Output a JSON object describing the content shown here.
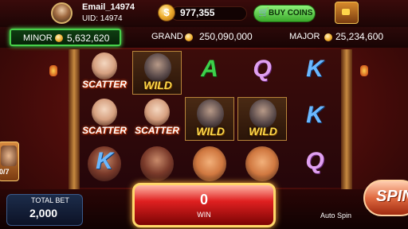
{
  "header": {
    "email": "Email_14974",
    "uid": "UID: 14974",
    "coin_symbol": "$",
    "balance": "977,355",
    "buy_coins_label": "BUY COINS"
  },
  "jackpots": {
    "minor_label": "MINOR",
    "minor_value": "5,632,620",
    "grand_label": "GRAND",
    "grand_value": "250,090,000",
    "major_label": "MAJOR",
    "major_value": "25,234,600"
  },
  "reels": [
    [
      {
        "type": "scatter",
        "label": "SCATTER"
      },
      {
        "type": "scatter",
        "label": "SCATTER"
      },
      {
        "type": "general",
        "label": ""
      }
    ],
    [
      {
        "type": "wild",
        "label": "WILD"
      },
      {
        "type": "scatter",
        "label": "SCATTER"
      },
      {
        "type": "general",
        "label": ""
      }
    ],
    [
      {
        "type": "letter",
        "label": "A"
      },
      {
        "type": "wild",
        "label": "WILD"
      },
      {
        "type": "pig",
        "label": ""
      }
    ],
    [
      {
        "type": "letter",
        "label": "Q"
      },
      {
        "type": "wild",
        "label": "WILD"
      },
      {
        "type": "pig",
        "label": ""
      }
    ],
    [
      {
        "type": "letter",
        "label": "K"
      },
      {
        "type": "letter",
        "label": "K"
      },
      {
        "type": "letter",
        "label": "Q"
      }
    ]
  ],
  "left_reel_stub": {
    "type": "letter",
    "label": "K"
  },
  "side_panel": {
    "count": "0/7"
  },
  "bottom": {
    "total_bet_label": "TOTAL BET",
    "total_bet_value": "2,000",
    "win_value": "0",
    "win_label": "WIN",
    "auto_spin_label": "Auto Spin",
    "spin_label": "SPIN"
  },
  "colors": {
    "minor_glow": "#47d04a",
    "buy_button": "#3aa82a",
    "win_panel": "#e02020"
  }
}
